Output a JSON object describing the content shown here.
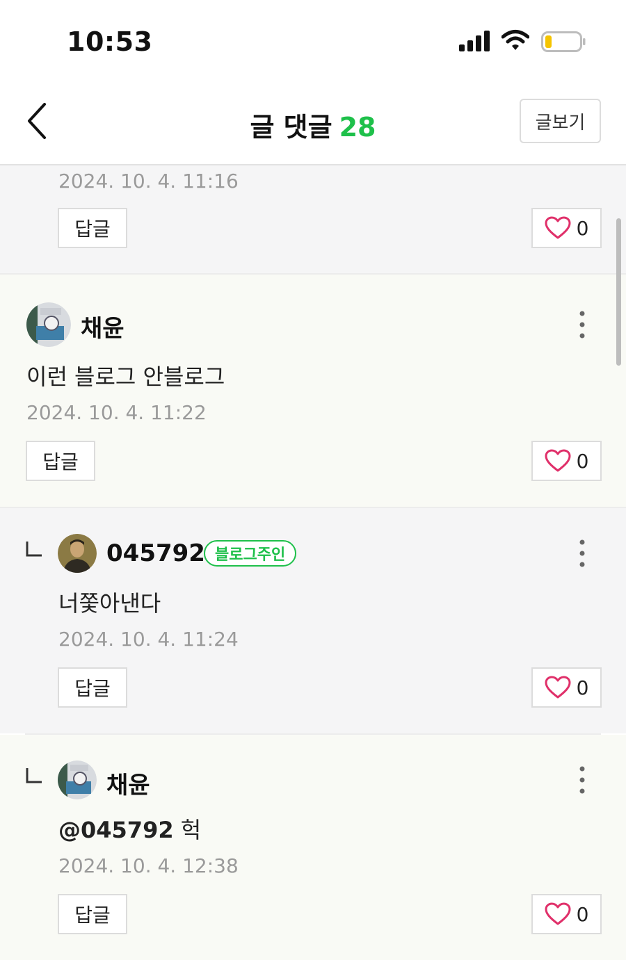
{
  "status_bar": {
    "time": "10:53",
    "signal_icon": "cellular-signal-icon",
    "wifi_icon": "wifi-icon",
    "battery_icon": "battery-low-icon",
    "battery_color": "#f5c400"
  },
  "header": {
    "back_icon": "chevron-left-icon",
    "title": "글 댓글",
    "comment_count": "28",
    "count_color": "#1ec04a",
    "view_post_label": "글보기"
  },
  "comments": [
    {
      "author": "",
      "text": "",
      "timestamp": "2024. 10. 4. 11:16",
      "reply_label": "답글",
      "likes": "0"
    },
    {
      "author": "채윤",
      "text": "이런 블로그 안블로그",
      "timestamp": "2024. 10. 4. 11:22",
      "reply_label": "답글",
      "likes": "0"
    },
    {
      "author": "045792",
      "badge": "블로그주인",
      "text": "너쫓아낸다",
      "timestamp": "2024. 10. 4. 11:24",
      "reply_label": "답글",
      "likes": "0"
    },
    {
      "author": "채윤",
      "mention": "@045792",
      "text": " 헉",
      "timestamp": "2024. 10. 4. 12:38",
      "reply_label": "답글",
      "likes": "0"
    }
  ],
  "colors": {
    "accent_green": "#1ec04a",
    "heart_pink": "#e0306a",
    "timestamp_gray": "#9a9a9a"
  }
}
